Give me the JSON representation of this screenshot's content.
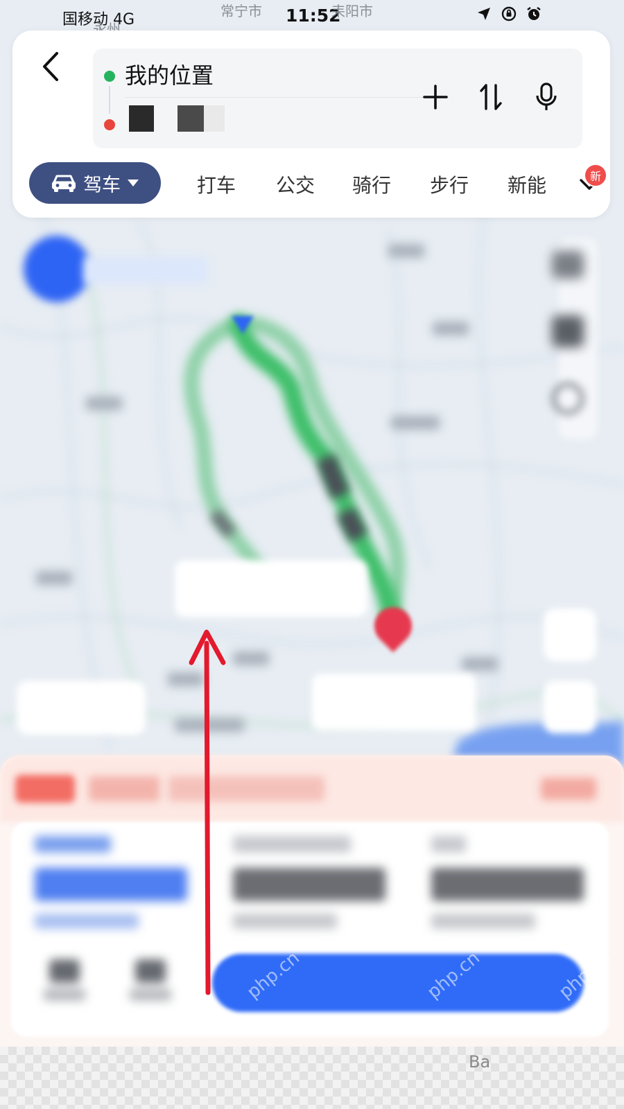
{
  "status_bar": {
    "carrier": "国移动 4G",
    "time": "11:52",
    "map_labels": [
      "常宁市",
      "耒阳市",
      "永州"
    ]
  },
  "route": {
    "origin": "我的位置",
    "destination": ""
  },
  "modes": {
    "active": "驾车",
    "items": [
      "打车",
      "公交",
      "骑行",
      "步行",
      "新能"
    ],
    "badge": "新"
  },
  "watermark": "php.cn",
  "corner_mark": "Ba",
  "icons": {
    "back": "chevron-left-icon",
    "add": "plus-icon",
    "swap": "swap-icon",
    "voice": "microphone-icon",
    "car": "car-icon",
    "expand": "chevron-down-icon"
  },
  "colors": {
    "accent_blue": "#2f6bf7",
    "drive_pill": "#3e4f82",
    "route_green": "#3fbf6a",
    "route_alt": "#8fd1a8",
    "destination_red": "#e6394f",
    "annotation_red": "#e3192d"
  }
}
